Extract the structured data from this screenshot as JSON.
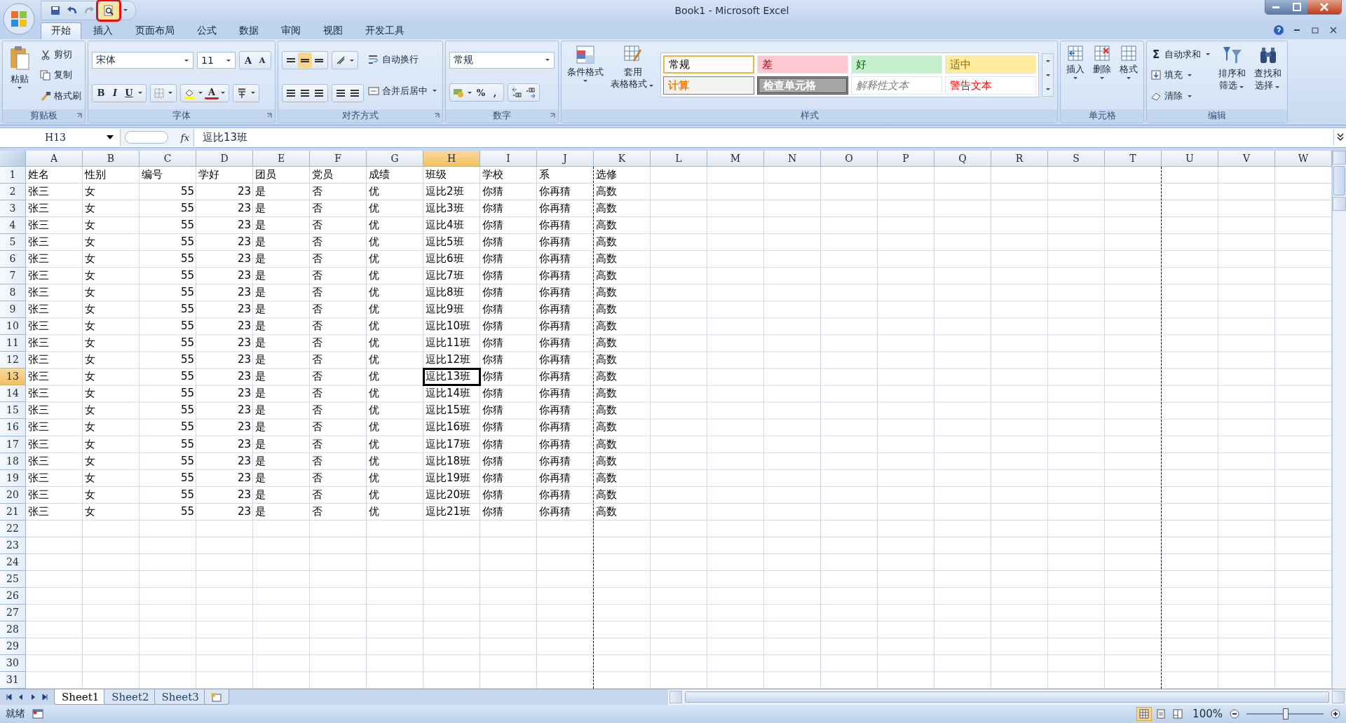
{
  "window": {
    "title": "Book1 - Microsoft Excel",
    "print_preview_marked": true
  },
  "ribbon_tabs": [
    {
      "label": "开始",
      "selected": true
    },
    {
      "label": "插入",
      "selected": false
    },
    {
      "label": "页面布局",
      "selected": false
    },
    {
      "label": "公式",
      "selected": false
    },
    {
      "label": "数据",
      "selected": false
    },
    {
      "label": "审阅",
      "selected": false
    },
    {
      "label": "视图",
      "selected": false
    },
    {
      "label": "开发工具",
      "selected": false
    }
  ],
  "clipboard": {
    "title": "剪贴板",
    "paste": "粘贴",
    "items": [
      "剪切",
      "复制",
      "格式刷"
    ]
  },
  "font": {
    "title": "字体",
    "name": "宋体",
    "size": "11",
    "grow": "A",
    "shrink": "A",
    "bold": "B",
    "italic": "I",
    "underline": "U",
    "color_glyph": "A"
  },
  "alignment": {
    "title": "对齐方式",
    "wrap": "自动换行",
    "merge": "合并后居中"
  },
  "number": {
    "title": "数字",
    "format": "常规",
    "percent": "%",
    "comma": ","
  },
  "styles": {
    "title": "样式",
    "conditional": "条件格式",
    "table_format": [
      "套用",
      "表格格式"
    ],
    "cells": [
      {
        "label": "常规",
        "kind": "normal",
        "color": "#ffffff",
        "selected": true
      },
      {
        "label": "差",
        "kind": "bad",
        "color": "#ffc7ce",
        "selected": false
      },
      {
        "label": "好",
        "kind": "good",
        "color": "#c6efce",
        "selected": false
      },
      {
        "label": "适中",
        "kind": "neutral",
        "color": "#ffeb9c",
        "selected": false
      },
      {
        "label": "计算",
        "kind": "calculation",
        "color": "#f2f2f2",
        "selected": false
      },
      {
        "label": "检查单元格",
        "kind": "check",
        "color": "#a5a5a5",
        "selected": false
      },
      {
        "label": "解释性文本",
        "kind": "explanatory",
        "color": "#ffffff",
        "selected": false
      },
      {
        "label": "警告文本",
        "kind": "warning",
        "color": "#ffffff",
        "selected": false
      }
    ]
  },
  "cells": {
    "title": "单元格",
    "buttons": [
      "插入",
      "删除",
      "格式"
    ]
  },
  "editing": {
    "title": "编辑",
    "sum_glyph": "Σ",
    "items": [
      "自动求和",
      "填充",
      "清除"
    ],
    "sort": [
      "排序和",
      "筛选"
    ],
    "find": [
      "查找和",
      "选择"
    ]
  },
  "formula_bar": {
    "name_box": "H13",
    "function_glyph": "fx",
    "formula": "逗比13班"
  },
  "sheet": {
    "columns": [
      {
        "header": "A",
        "selected": false,
        "page_break": false
      },
      {
        "header": "B",
        "selected": false,
        "page_break": false
      },
      {
        "header": "C",
        "selected": false,
        "page_break": false
      },
      {
        "header": "D",
        "selected": false,
        "page_break": false
      },
      {
        "header": "E",
        "selected": false,
        "page_break": false
      },
      {
        "header": "F",
        "selected": false,
        "page_break": false
      },
      {
        "header": "G",
        "selected": false,
        "page_break": false
      },
      {
        "header": "H",
        "selected": true,
        "page_break": false
      },
      {
        "header": "I",
        "selected": false,
        "page_break": false
      },
      {
        "header": "J",
        "selected": false,
        "page_break": true
      },
      {
        "header": "K",
        "selected": false,
        "page_break": false
      },
      {
        "header": "L",
        "selected": false,
        "page_break": false
      },
      {
        "header": "M",
        "selected": false,
        "page_break": false
      },
      {
        "header": "N",
        "selected": false,
        "page_break": false
      },
      {
        "header": "O",
        "selected": false,
        "page_break": false
      },
      {
        "header": "P",
        "selected": false,
        "page_break": false
      },
      {
        "header": "Q",
        "selected": false,
        "page_break": false
      },
      {
        "header": "R",
        "selected": false,
        "page_break": false
      },
      {
        "header": "S",
        "selected": false,
        "page_break": false
      },
      {
        "header": "T",
        "selected": false,
        "page_break": true
      },
      {
        "header": "U",
        "selected": false,
        "page_break": false
      },
      {
        "header": "V",
        "selected": false,
        "page_break": false
      },
      {
        "header": "W",
        "selected": false,
        "page_break": false
      }
    ],
    "rows": [
      {
        "header": "1",
        "selected": false,
        "cells": [
          "姓名",
          "性别",
          "编号",
          "学好",
          "团员",
          "党员",
          "成绩",
          "班级",
          "学校",
          "系",
          "选修"
        ]
      },
      {
        "header": "2",
        "selected": false,
        "cells": [
          "张三",
          "女",
          "55",
          "23",
          "是",
          "否",
          "优",
          "逗比2班",
          "你猜",
          "你再猜",
          "高数"
        ]
      },
      {
        "header": "3",
        "selected": false,
        "cells": [
          "张三",
          "女",
          "55",
          "23",
          "是",
          "否",
          "优",
          "逗比3班",
          "你猜",
          "你再猜",
          "高数"
        ]
      },
      {
        "header": "4",
        "selected": false,
        "cells": [
          "张三",
          "女",
          "55",
          "23",
          "是",
          "否",
          "优",
          "逗比4班",
          "你猜",
          "你再猜",
          "高数"
        ]
      },
      {
        "header": "5",
        "selected": false,
        "cells": [
          "张三",
          "女",
          "55",
          "23",
          "是",
          "否",
          "优",
          "逗比5班",
          "你猜",
          "你再猜",
          "高数"
        ]
      },
      {
        "header": "6",
        "selected": false,
        "cells": [
          "张三",
          "女",
          "55",
          "23",
          "是",
          "否",
          "优",
          "逗比6班",
          "你猜",
          "你再猜",
          "高数"
        ]
      },
      {
        "header": "7",
        "selected": false,
        "cells": [
          "张三",
          "女",
          "55",
          "23",
          "是",
          "否",
          "优",
          "逗比7班",
          "你猜",
          "你再猜",
          "高数"
        ]
      },
      {
        "header": "8",
        "selected": false,
        "cells": [
          "张三",
          "女",
          "55",
          "23",
          "是",
          "否",
          "优",
          "逗比8班",
          "你猜",
          "你再猜",
          "高数"
        ]
      },
      {
        "header": "9",
        "selected": false,
        "cells": [
          "张三",
          "女",
          "55",
          "23",
          "是",
          "否",
          "优",
          "逗比9班",
          "你猜",
          "你再猜",
          "高数"
        ]
      },
      {
        "header": "10",
        "selected": false,
        "cells": [
          "张三",
          "女",
          "55",
          "23",
          "是",
          "否",
          "优",
          "逗比10班",
          "你猜",
          "你再猜",
          "高数"
        ]
      },
      {
        "header": "11",
        "selected": false,
        "cells": [
          "张三",
          "女",
          "55",
          "23",
          "是",
          "否",
          "优",
          "逗比11班",
          "你猜",
          "你再猜",
          "高数"
        ]
      },
      {
        "header": "12",
        "selected": false,
        "cells": [
          "张三",
          "女",
          "55",
          "23",
          "是",
          "否",
          "优",
          "逗比12班",
          "你猜",
          "你再猜",
          "高数"
        ]
      },
      {
        "header": "13",
        "selected": true,
        "cells": [
          "张三",
          "女",
          "55",
          "23",
          "是",
          "否",
          "优",
          "逗比13班",
          "你猜",
          "你再猜",
          "高数"
        ]
      },
      {
        "header": "14",
        "selected": false,
        "cells": [
          "张三",
          "女",
          "55",
          "23",
          "是",
          "否",
          "优",
          "逗比14班",
          "你猜",
          "你再猜",
          "高数"
        ]
      },
      {
        "header": "15",
        "selected": false,
        "cells": [
          "张三",
          "女",
          "55",
          "23",
          "是",
          "否",
          "优",
          "逗比15班",
          "你猜",
          "你再猜",
          "高数"
        ]
      },
      {
        "header": "16",
        "selected": false,
        "cells": [
          "张三",
          "女",
          "55",
          "23",
          "是",
          "否",
          "优",
          "逗比16班",
          "你猜",
          "你再猜",
          "高数"
        ]
      },
      {
        "header": "17",
        "selected": false,
        "cells": [
          "张三",
          "女",
          "55",
          "23",
          "是",
          "否",
          "优",
          "逗比17班",
          "你猜",
          "你再猜",
          "高数"
        ]
      },
      {
        "header": "18",
        "selected": false,
        "cells": [
          "张三",
          "女",
          "55",
          "23",
          "是",
          "否",
          "优",
          "逗比18班",
          "你猜",
          "你再猜",
          "高数"
        ]
      },
      {
        "header": "19",
        "selected": false,
        "cells": [
          "张三",
          "女",
          "55",
          "23",
          "是",
          "否",
          "优",
          "逗比19班",
          "你猜",
          "你再猜",
          "高数"
        ]
      },
      {
        "header": "20",
        "selected": false,
        "cells": [
          "张三",
          "女",
          "55",
          "23",
          "是",
          "否",
          "优",
          "逗比20班",
          "你猜",
          "你再猜",
          "高数"
        ]
      },
      {
        "header": "21",
        "selected": false,
        "cells": [
          "张三",
          "女",
          "55",
          "23",
          "是",
          "否",
          "优",
          "逗比21班",
          "你猜",
          "你再猜",
          "高数"
        ]
      },
      {
        "header": "22",
        "selected": false
      },
      {
        "header": "23",
        "selected": false
      },
      {
        "header": "24",
        "selected": false
      },
      {
        "header": "25",
        "selected": false
      },
      {
        "header": "26",
        "selected": false
      },
      {
        "header": "27",
        "selected": false
      },
      {
        "header": "28",
        "selected": false
      },
      {
        "header": "29",
        "selected": false
      },
      {
        "header": "30",
        "selected": false
      },
      {
        "header": "31",
        "selected": false
      }
    ]
  },
  "sheet_tabs": [
    {
      "label": "Sheet1",
      "selected": true
    },
    {
      "label": "Sheet2",
      "selected": false
    },
    {
      "label": "Sheet3",
      "selected": false
    }
  ],
  "status_bar": {
    "status": "就绪",
    "zoom": "100%",
    "zoom_slider": {
      "level": 0.5
    }
  }
}
